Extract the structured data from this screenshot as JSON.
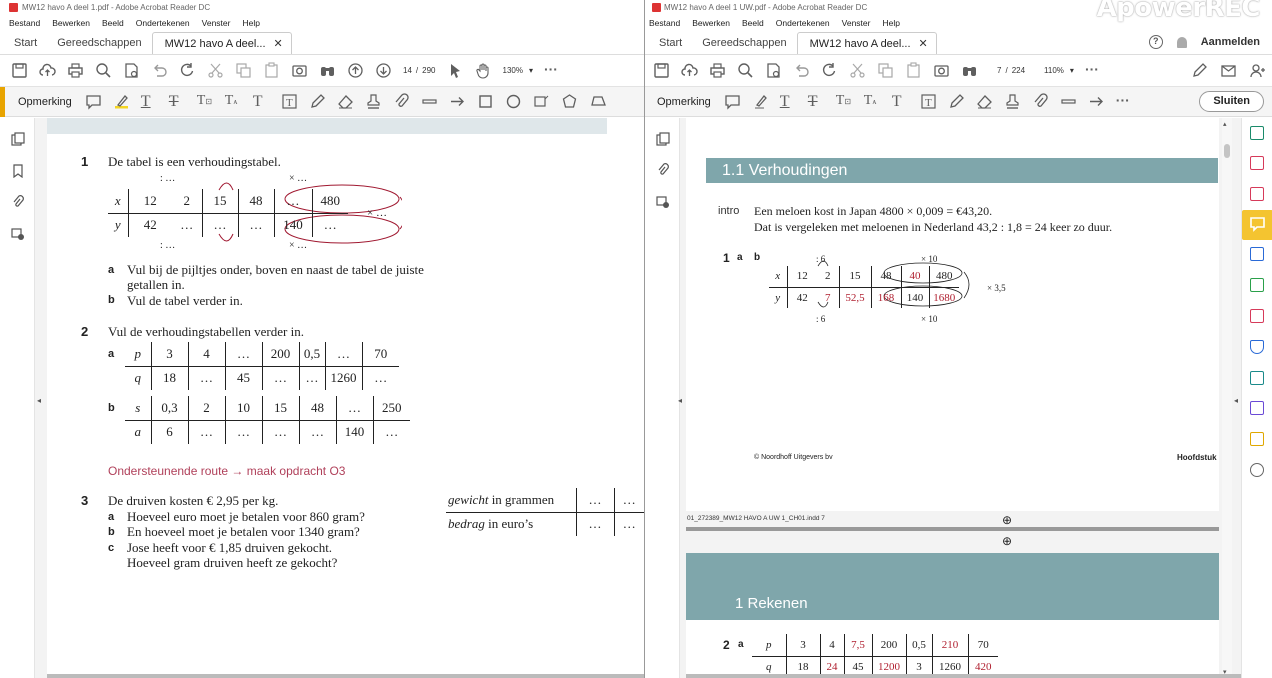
{
  "left": {
    "title": "MW12 havo A deel 1.pdf - Adobe Acrobat Reader DC",
    "menu": [
      "Bestand",
      "Bewerken",
      "Beeld",
      "Ondertekenen",
      "Venster",
      "Help"
    ],
    "tabs": {
      "start": "Start",
      "tools": "Gereedschappen",
      "doc": "MW12 havo A deel..."
    },
    "page_current": "14",
    "page_sep": "/",
    "page_total": "290",
    "zoom": "130%",
    "annotate_label": "Opmerking",
    "q1_num": "1",
    "q1_text": "De tabel is een verhoudingstabel.",
    "q1_table": {
      "x": [
        "x",
        "12",
        "2",
        "15",
        "48",
        "…",
        "480"
      ],
      "y": [
        "y",
        "42",
        "…",
        "…",
        "…",
        "140",
        "…"
      ]
    },
    "q1_arrows": {
      "top_left": ": …",
      "top_right": "× …",
      "bot_left": ": …",
      "bot_right": "× …",
      "side": "× …"
    },
    "q1a_l": "a",
    "q1a": "Vul bij de pijltjes onder, boven en naast de tabel de juiste",
    "q1a2": "getallen in.",
    "q1b_l": "b",
    "q1b": "Vul de tabel verder in.",
    "q2_num": "2",
    "q2_text": "Vul de verhoudingstabellen verder in.",
    "q2a_l": "a",
    "q2a": {
      "r1": [
        "p",
        "3",
        "4",
        "…",
        "200",
        "0,5",
        "…",
        "70"
      ],
      "r2": [
        "q",
        "18",
        "…",
        "45",
        "…",
        "…",
        "1260",
        "…"
      ]
    },
    "q2b_l": "b",
    "q2b": {
      "r1": [
        "s",
        "0,3",
        "2",
        "10",
        "15",
        "48",
        "…",
        "250"
      ],
      "r2": [
        "a",
        "6",
        "…",
        "…",
        "…",
        "…",
        "140",
        "…"
      ]
    },
    "support": "Ondersteunende route → maak opdracht O3",
    "q3_num": "3",
    "q3_text": "De druiven kosten € 2,95 per kg.",
    "q3a_l": "a",
    "q3a": "Hoeveel euro moet je betalen voor 860 gram?",
    "q3b_l": "b",
    "q3b": "En hoeveel moet je betalen voor 1340 gram?",
    "q3c_l": "c",
    "q3c": "Jose heeft voor € 1,85 druiven gekocht.",
    "q3c2": "Hoeveel gram druiven heeft ze gekocht?",
    "q3_table": {
      "r1": [
        "gewicht",
        "in grammen",
        "…",
        "…"
      ],
      "r2": [
        "bedrag",
        "in euro’s",
        "…",
        "…"
      ]
    }
  },
  "right": {
    "title": "MW12 havo A deel 1 UW.pdf - Adobe Acrobat Reader DC",
    "watermark": "ApowerREC",
    "menu": [
      "Bestand",
      "Bewerken",
      "Beeld",
      "Ondertekenen",
      "Venster",
      "Help"
    ],
    "tabs": {
      "start": "Start",
      "tools": "Gereedschappen",
      "doc": "MW12 havo A deel...",
      "help": "?",
      "signin": "Aanmelden"
    },
    "page_current": "7",
    "page_sep": "/",
    "page_total": "224",
    "zoom": "110%",
    "annotate_label": "Opmerking",
    "close_label": "Sluiten",
    "section": "1.1  Verhoudingen",
    "intro_label": "intro",
    "intro1": "Een meloen kost in Japan 4800 × 0,009 = €43,20.",
    "intro2": "Dat is vergeleken met meloenen in Nederland 43,2 : 1,8 = 24 keer zo duur.",
    "ans1_num": "1",
    "ans1_a": "a",
    "ans1_b": "b",
    "ans1_table": {
      "x": [
        "x",
        "12",
        "2",
        "15",
        "48",
        "40",
        "480"
      ],
      "y": [
        "y",
        "42",
        "7",
        "52,5",
        "168",
        "140",
        "1680"
      ]
    },
    "ans1_arrows": {
      "top_left": ": 6",
      "top_right": "× 10",
      "bot_left": ": 6",
      "bot_right": "× 10",
      "side": "× 3,5"
    },
    "copyright": "© Noordhoff Uitgevers bv",
    "chapter": "Hoofdstuk",
    "slug": "01_272389_MW12 HAVO A UW 1_CH01.indd   7",
    "section2": "1  Rekenen",
    "ans2_num": "2",
    "ans2_a": "a",
    "ans2_table": {
      "r1": [
        "p",
        "3",
        "4",
        "7,5",
        "200",
        "0,5",
        "210",
        "70"
      ],
      "r2": [
        "q",
        "18",
        "24",
        "45",
        "1200",
        "3",
        "1260",
        "420"
      ]
    }
  }
}
